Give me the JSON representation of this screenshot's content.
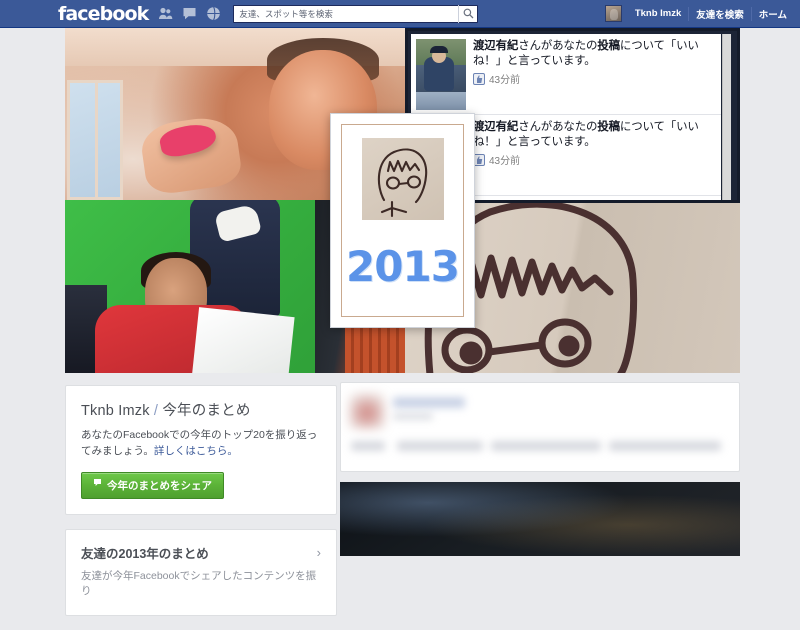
{
  "topbar": {
    "logo": "facebook",
    "icons": [
      {
        "name": "friend-requests-icon",
        "label": "friend-requests"
      },
      {
        "name": "messages-icon",
        "label": "messages"
      },
      {
        "name": "notifications-globe-icon",
        "label": "notifications"
      }
    ],
    "search": {
      "placeholder": "友達、スポット等を検索",
      "value": "",
      "icon": "search-icon"
    },
    "user_name": "Tknb Imzk",
    "links": [
      "友達を検索",
      "ホーム"
    ],
    "brand_color": "#3b5998"
  },
  "notifications": [
    {
      "text_prefix": "渡辺有紀",
      "text_rest": "さんがあなたの",
      "text_bold2": "投稿",
      "text_tail": "について「いいね！」と言っています。",
      "time": "43分前",
      "icon": "thumbs-up-icon"
    },
    {
      "text_prefix": "渡辺有紀",
      "text_rest": "さんがあなたの",
      "text_bold2": "投稿",
      "text_tail": "について「いいね！」と言っています。",
      "time": "43分前",
      "icon": "thumbs-up-icon"
    }
  ],
  "year_card": {
    "year": "2013",
    "accent_color": "#5b93e8"
  },
  "summary_card": {
    "title_name": "Tknb Imzk",
    "title_sep": " / ",
    "title_rest": "今年のまとめ",
    "description": "あなたのFacebookでの今年のトップ20を振り返ってみましょう。",
    "link_text": "詳しくはこちら。",
    "share_button": "今年のまとめをシェア",
    "share_icon": "share-flag-icon",
    "button_color": "#5cb338"
  },
  "friends_card": {
    "title": "友達の2013年のまとめ",
    "chevron": "›",
    "description": "友達が今年Facebookでシェアしたコンテンツを振り"
  }
}
